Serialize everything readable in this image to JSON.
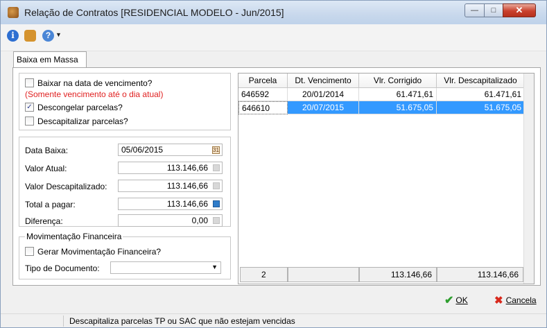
{
  "window": {
    "title": "Relação de Contratos [RESIDENCIAL MODELO - Jun/2015]",
    "controls": {
      "minimize": "—",
      "maximize": "□",
      "close": "✕"
    }
  },
  "toolbar": {
    "icons": [
      "info-icon",
      "user-icon",
      "help-icon"
    ],
    "info_glyph": "i",
    "help_glyph": "?",
    "dropdown_glyph": "▼"
  },
  "tab": {
    "label": "Baixa em Massa"
  },
  "options": {
    "baixar_vencimento": {
      "label": "Baixar na data de vencimento?",
      "checked": false
    },
    "note": "(Somente vencimento até o dia atual)",
    "descongelar": {
      "label": "Descongelar parcelas?",
      "checked": true,
      "mark": "✓"
    },
    "descapitalizar": {
      "label": "Descapitalizar parcelas?",
      "checked": false
    }
  },
  "fields": {
    "data_baixa": {
      "label": "Data Baixa:",
      "value": "05/06/2015",
      "button_glyph": "31"
    },
    "valor_atual": {
      "label": "Valor Atual:",
      "value": "113.146,66"
    },
    "valor_descap": {
      "label": "Valor Descapitalizado:",
      "value": "113.146,66"
    },
    "total_pagar": {
      "label": "Total a pagar:",
      "value": "113.146,66"
    },
    "diferenca": {
      "label": "Diferença:",
      "value": "0,00"
    }
  },
  "movimentacao": {
    "legend": "Movimentação Financeira",
    "gerar": {
      "label": "Gerar Movimentação Financeira?",
      "checked": false
    },
    "tipo_label": "Tipo de Documento:",
    "tipo_value": "",
    "combo_arrow": "▼"
  },
  "grid": {
    "columns": [
      "Parcela",
      "Dt. Vencimento",
      "Vlr. Corrigido",
      "Vlr. Descapitalizado"
    ],
    "rows": [
      {
        "parcela": "646592",
        "vencimento": "20/01/2014",
        "corrigido": "61.471,61",
        "descap": "61.471,61",
        "selected": false
      },
      {
        "parcela": "646610",
        "vencimento": "20/07/2015",
        "corrigido": "51.675,05",
        "descap": "51.675,05",
        "selected": true
      }
    ],
    "footer": {
      "count": "2",
      "total_corrigido": "113.146,66",
      "total_descap": "113.146,66"
    }
  },
  "buttons": {
    "ok": {
      "label": "OK",
      "icon": "✔"
    },
    "cancel": {
      "label": "Cancela",
      "icon": "✖"
    }
  },
  "status": {
    "text": "Descapitaliza parcelas TP ou SAC que não estejam vencidas"
  }
}
